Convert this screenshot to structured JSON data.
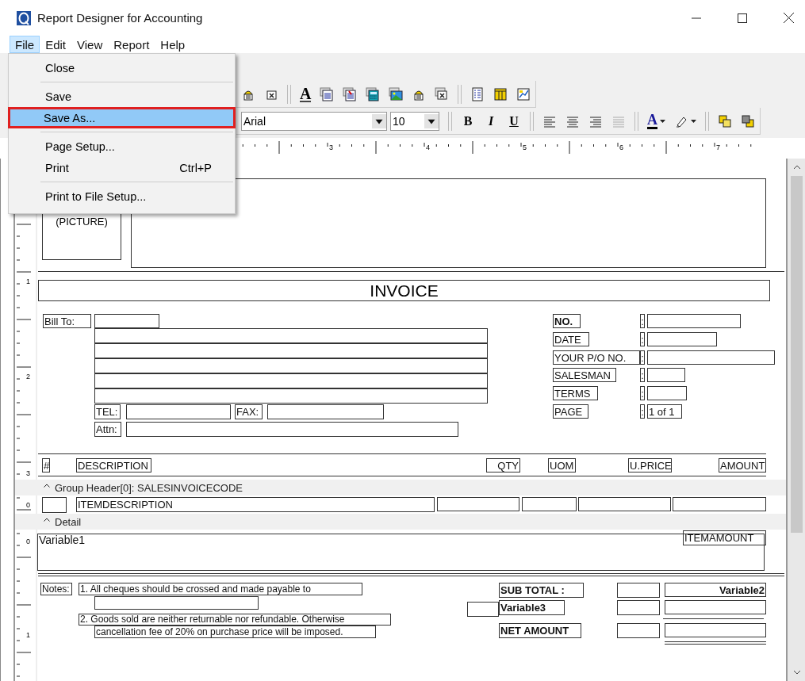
{
  "window": {
    "title": "Report Designer for Accounting"
  },
  "menu_bar": [
    {
      "label": "File",
      "selected": true
    },
    {
      "label": "Edit",
      "selected": false
    },
    {
      "label": "View",
      "selected": false
    },
    {
      "label": "Report",
      "selected": false
    },
    {
      "label": "Help",
      "selected": false
    }
  ],
  "file_menu": [
    {
      "kind": "item",
      "label": "Close",
      "selected": false
    },
    {
      "kind": "separator"
    },
    {
      "kind": "item",
      "label": "Save",
      "selected": false
    },
    {
      "kind": "item",
      "label": "Save As...",
      "selected": true
    },
    {
      "kind": "separator"
    },
    {
      "kind": "item",
      "label": "Page Setup...",
      "selected": false
    },
    {
      "kind": "item",
      "label": "Print",
      "shortcut": "Ctrl+P",
      "selected": false
    },
    {
      "kind": "separator"
    },
    {
      "kind": "item",
      "label": "Print to File Setup...",
      "selected": false
    }
  ],
  "toolbar": {
    "text_tool_glyph": "A",
    "font": {
      "value": "Arial"
    },
    "size": {
      "value": "10"
    },
    "format_buttons": [
      "B",
      "I",
      "U"
    ],
    "font_color_glyph": "A"
  },
  "horizontal_ruler": {
    "labels": [
      "3",
      "4",
      "5",
      "6",
      "7"
    ]
  },
  "vertical_ruler": {
    "labels": [
      "1",
      "2",
      "3",
      "0",
      "0",
      "1"
    ]
  },
  "report": {
    "picture_placeholder": "(PICTURE)",
    "title": "INVOICE",
    "bill_to": {
      "label": "Bill To:",
      "tel_label": "TEL:",
      "fax_label": "FAX:",
      "attn_label": "Attn:"
    },
    "info_fields": [
      {
        "label": "NO.",
        "bold": true,
        "separator": ":"
      },
      {
        "label": "DATE",
        "bold": false,
        "separator": ":"
      },
      {
        "label": "YOUR P/O NO.",
        "bold": false,
        "separator": ":"
      },
      {
        "label": "SALESMAN",
        "bold": false,
        "separator": ":"
      },
      {
        "label": "TERMS",
        "bold": false,
        "separator": ":"
      },
      {
        "label": "PAGE",
        "bold": false,
        "separator": ":",
        "value": "1 of 1"
      }
    ],
    "columns": [
      "#",
      "DESCRIPTION",
      "QTY",
      "UOM",
      "U.PRICE",
      "AMOUNT"
    ],
    "bands": [
      "Group Header[0]: SALESINVOICECODE",
      "Detail"
    ],
    "group_field": "ITEMDESCRIPTION",
    "detail": {
      "variable": "Variable1",
      "amount": "ITEMAMOUNT"
    },
    "notes": {
      "label": "Notes:",
      "lines": [
        "1.  All cheques should be crossed and made payable to",
        "2.  Goods sold are neither returnable nor refundable. Otherwise",
        "cancellation fee of 20% on purchase price will be imposed."
      ]
    },
    "totals": [
      {
        "label": "SUB TOTAL :",
        "value": "Variable2"
      },
      {
        "label": "Variable3"
      },
      {
        "label": "NET AMOUNT"
      }
    ]
  }
}
